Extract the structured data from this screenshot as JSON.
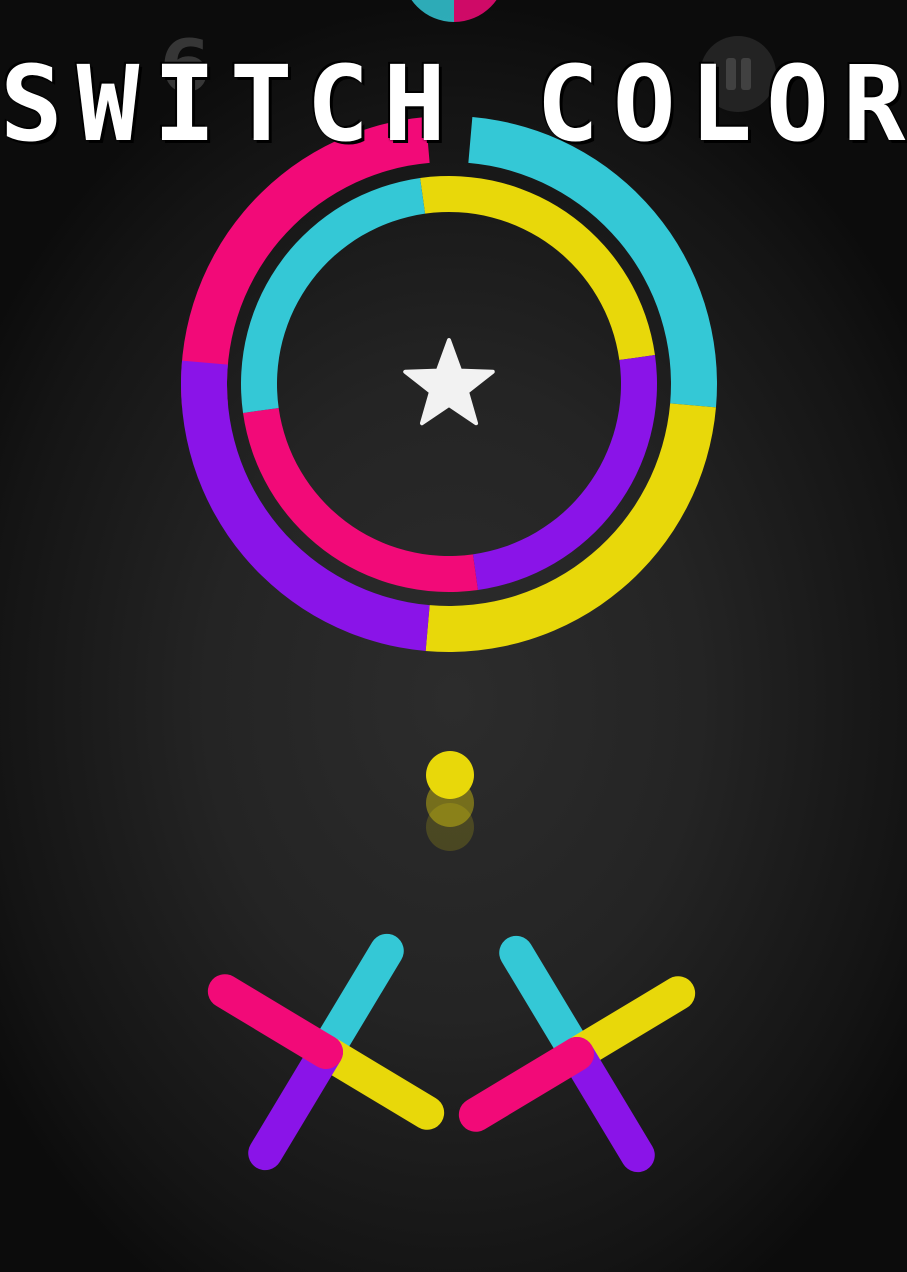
{
  "game": {
    "title": "SWITCH COLOR",
    "score": "6",
    "pause_icon": "pause-icon",
    "star_icon": "star-icon",
    "player_ball_color": "#e8d80a"
  },
  "palette": {
    "magenta": "#f20a78",
    "cyan": "#34c8d6",
    "yellow": "#e8d80a",
    "purple": "#8a14e8",
    "background": "#232323"
  },
  "obstacles": {
    "outer_ring_colors": [
      "magenta",
      "cyan",
      "yellow",
      "purple"
    ],
    "inner_ring_colors": [
      "yellow",
      "purple",
      "magenta",
      "cyan"
    ],
    "left_cross_colors": [
      "cyan",
      "yellow",
      "purple",
      "magenta"
    ],
    "right_cross_colors": [
      "cyan",
      "yellow",
      "purple",
      "magenta"
    ],
    "top_ring_partial_colors": [
      "cyan",
      "magenta"
    ]
  }
}
